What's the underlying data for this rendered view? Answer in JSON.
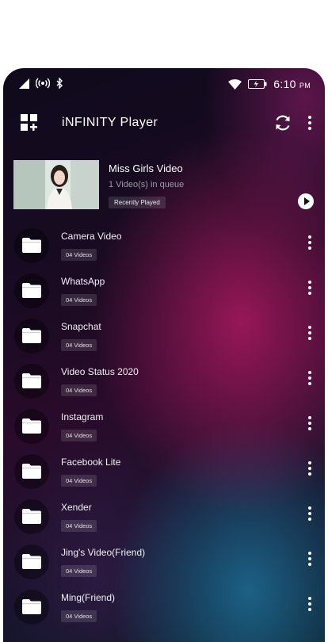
{
  "status_bar": {
    "time": "6:10",
    "ampm": "PM",
    "icons": [
      "signal-icon",
      "hotspot-icon",
      "bluetooth-icon",
      "wifi-icon",
      "battery-icon"
    ]
  },
  "app": {
    "title": "iNFINITY Player",
    "icons": [
      "app-grid-icon",
      "refresh-icon",
      "more-vert-icon"
    ]
  },
  "now_playing": {
    "title": "Miss Girls Video",
    "subtitle": "1 Video(s) in queue",
    "badge": "Recently Played"
  },
  "folders": [
    {
      "name": "Camera Video",
      "count": "04 Videos"
    },
    {
      "name": "WhatsApp",
      "count": "04 Videos"
    },
    {
      "name": "Snapchat",
      "count": "04 Videos"
    },
    {
      "name": "Video Status 2020",
      "count": "04 Videos"
    },
    {
      "name": "Instagram",
      "count": "04 Videos"
    },
    {
      "name": "Facebook Lite",
      "count": "04 Videos"
    },
    {
      "name": "Xender",
      "count": "04 Videos"
    },
    {
      "name": "Jing's Video(Friend)",
      "count": "04 Videos"
    },
    {
      "name": "Ming(Friend)",
      "count": "04 Videos"
    }
  ],
  "colors": {
    "accent_pink": "#a8195f",
    "accent_teal": "#1e6e96",
    "background_dark": "#0f0a1c"
  }
}
